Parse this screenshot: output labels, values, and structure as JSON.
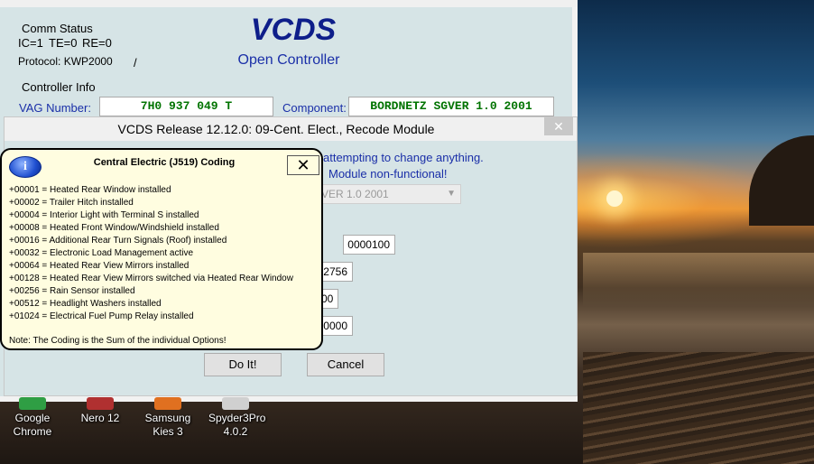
{
  "main_window": {
    "title_snippet": "",
    "comm_status_label": "Comm Status",
    "ic": "IC=1",
    "te": "TE=0",
    "re": "RE=0",
    "protocol": "Protocol: KWP2000",
    "protocol_sep": "/",
    "app_title": "VCDS",
    "subtitle": "Open Controller",
    "controller_info_label": "Controller Info",
    "vag_label": "VAG Number:",
    "vag_value": "7H0 937 049 T",
    "component_label": "Component:",
    "component_value": "BORDNETZ SGVER 1.0  2001"
  },
  "recode_dialog": {
    "title": "VCDS Release 12.12.0: 09-Cent. Elect.,  Recode Module",
    "close_glyph": "✕",
    "warning_line1": "attempting to change anything.",
    "warning_line2": "Module non-functional!",
    "component_select_value": "VER 1.0  2001",
    "field_coding_value": "0000100",
    "field_2_value": "2756",
    "field_3_value": "00",
    "field_4_value": "0000",
    "do_it_label": "Do It!",
    "cancel_label": "Cancel"
  },
  "balloon": {
    "title": "Central Electric (J519) Coding",
    "info_glyph": "i",
    "close_glyph": "✕",
    "items": [
      "+00001 = Heated Rear Window installed",
      "+00002 = Trailer Hitch installed",
      "+00004 = Interior Light with Terminal S installed",
      "+00008 = Heated Front Window/Windshield installed",
      "+00016 = Additional Rear Turn Signals (Roof) installed",
      "+00032 = Electronic Load Management active",
      "+00064 = Heated Rear View Mirrors installed",
      "+00128 = Heated Rear View Mirrors switched via Heated Rear Window",
      "+00256 = Rain Sensor installed",
      "+00512 = Headlight Washers installed",
      "+01024 = Electrical Fuel Pump Relay installed"
    ],
    "note": "Note: The Coding is the Sum of the individual Options!"
  },
  "desktop_icons": [
    {
      "label_1": "Google",
      "label_2": "Chrome",
      "color": "#2f9e44"
    },
    {
      "label_1": "Nero 12",
      "label_2": "",
      "color": "#b03030"
    },
    {
      "label_1": "Samsung",
      "label_2": "Kies 3",
      "color": "#e07020"
    },
    {
      "label_1": "Spyder3Pro",
      "label_2": "4.0.2",
      "color": "#d0d0d0"
    }
  ],
  "colors": {
    "window_bg": "#d6e4e6",
    "title_blue": "#0e1e8a",
    "label_blue": "#1a2fa8",
    "field_green": "#007300",
    "balloon_bg": "#fffde0"
  }
}
